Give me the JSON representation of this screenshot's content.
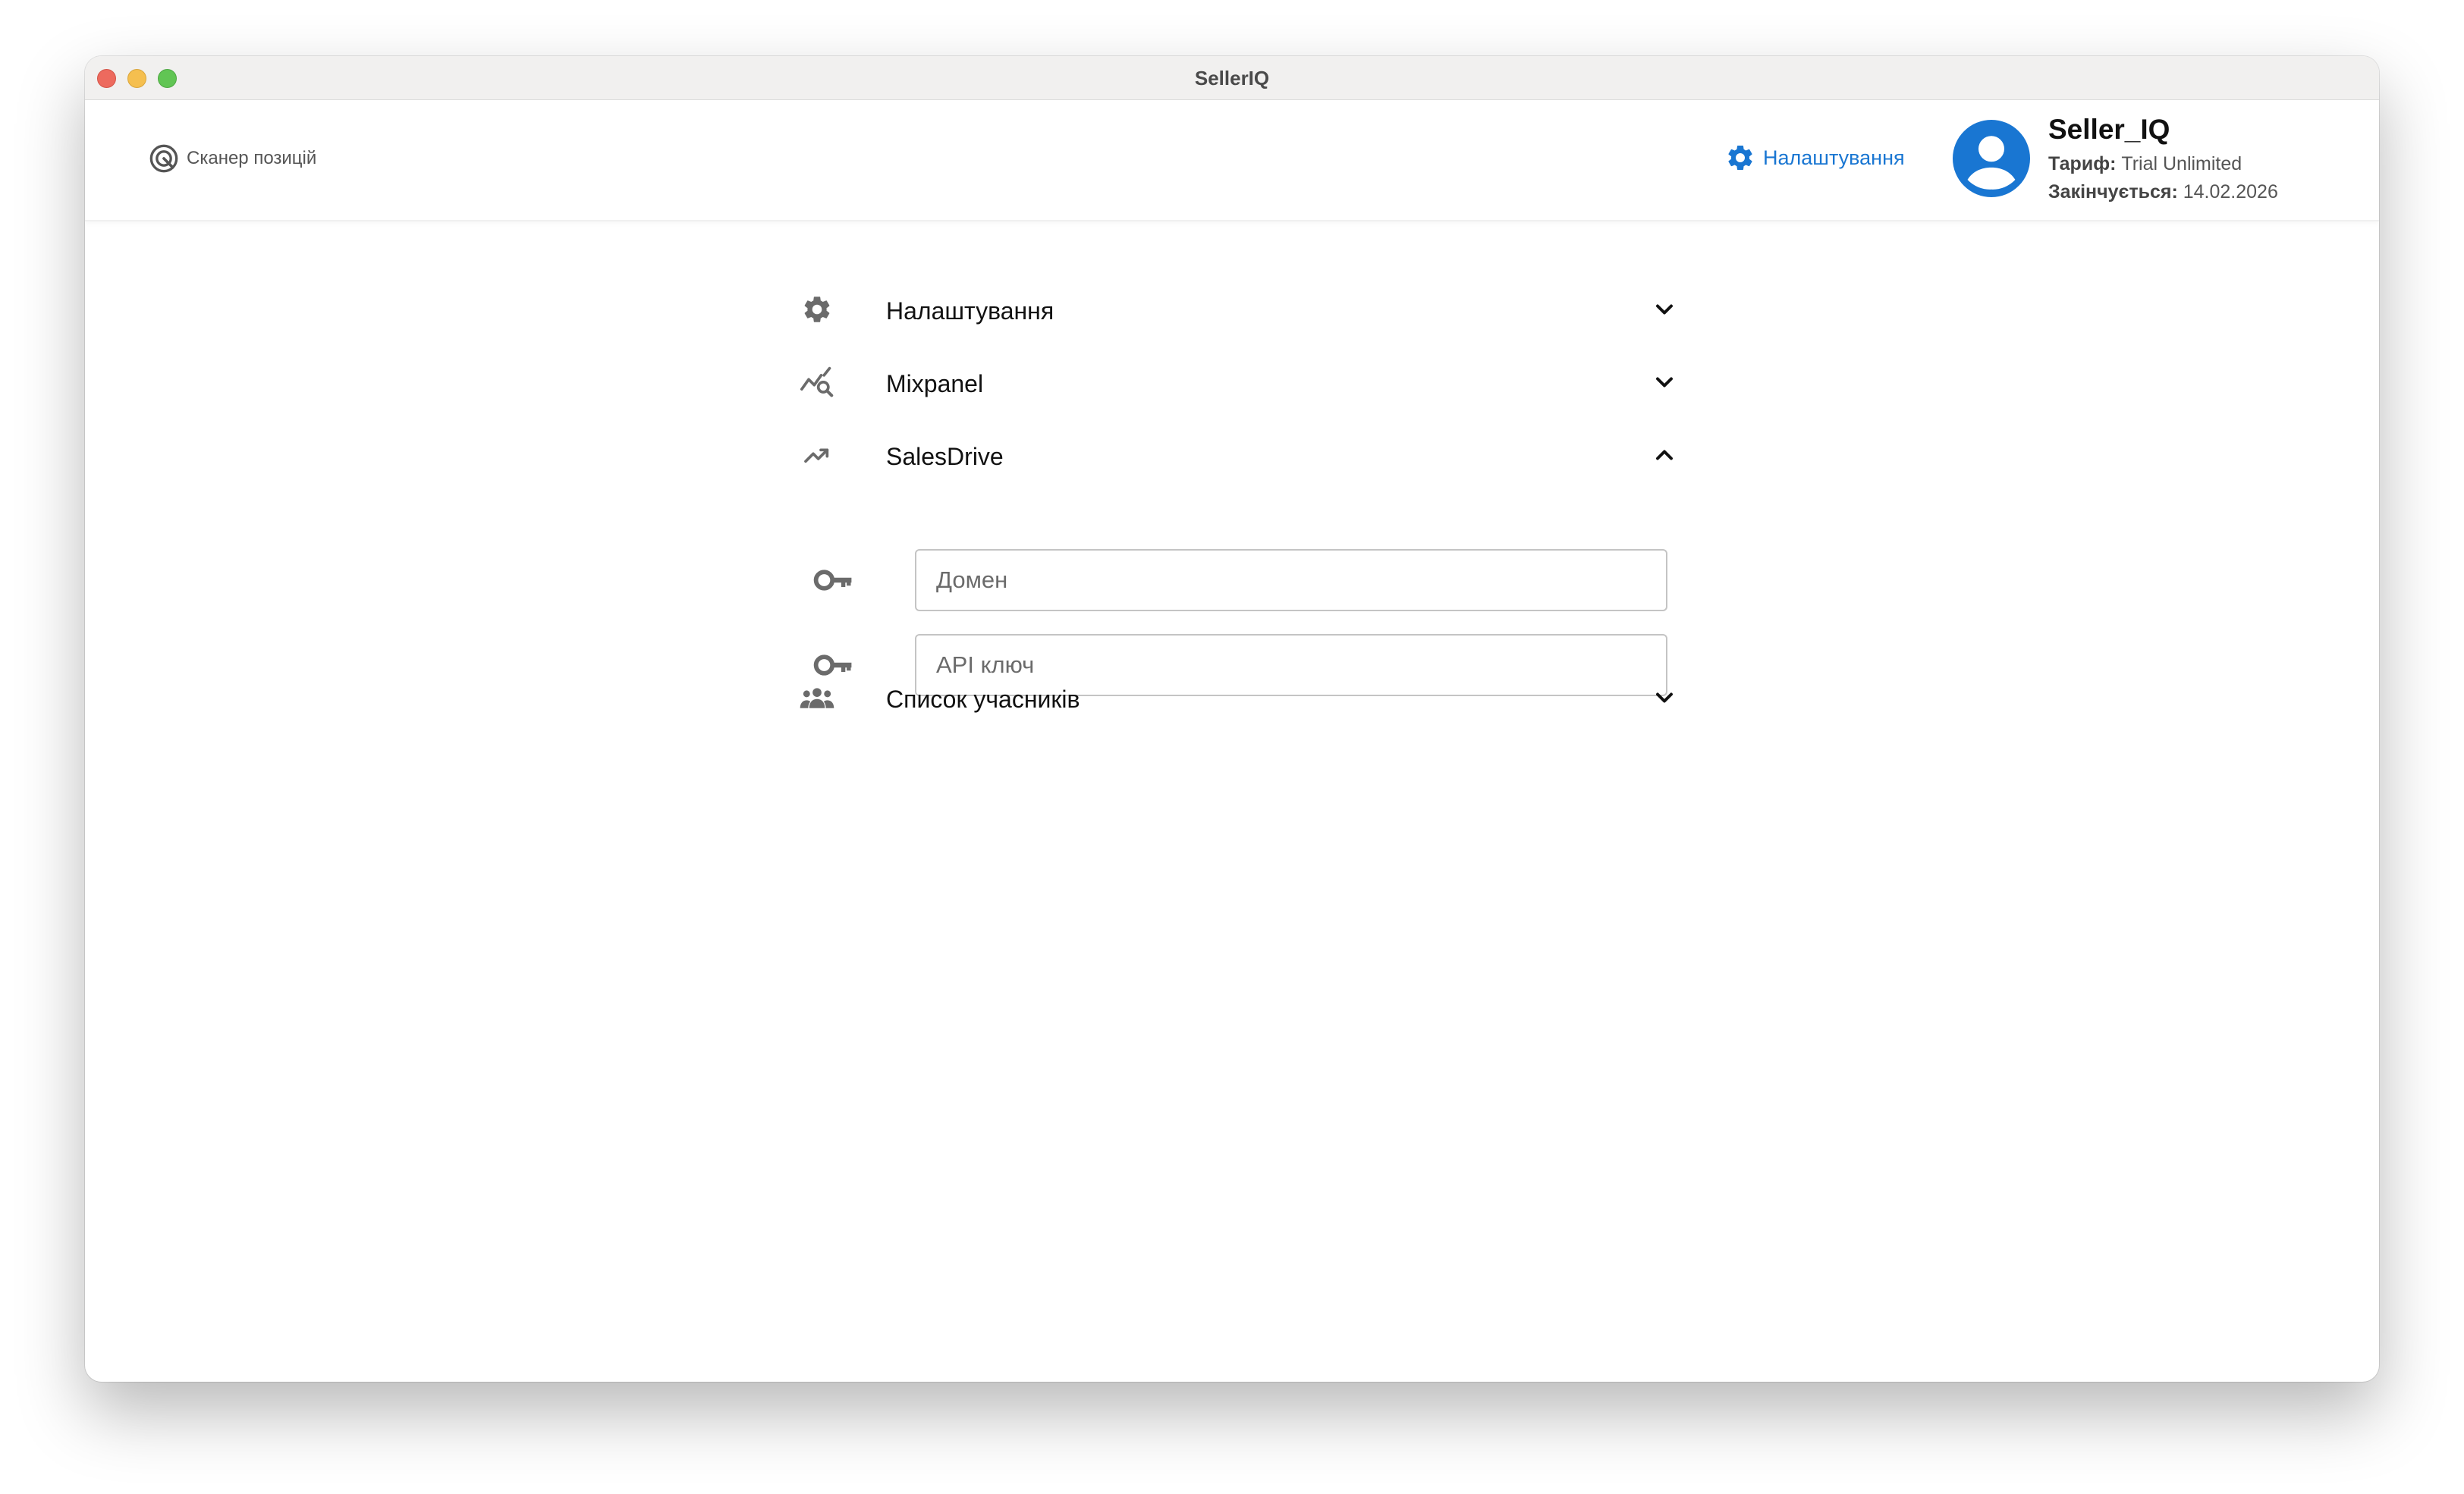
{
  "window": {
    "title": "SellerIQ"
  },
  "header": {
    "scanner_label": "Сканер позицій",
    "settings_label": "Налаштування",
    "user": {
      "name": "Seller_IQ",
      "plan_key": "Тариф:",
      "plan_value": "Trial Unlimited",
      "expires_key": "Закінчується:",
      "expires_value": "14.02.2026"
    }
  },
  "sections": {
    "settings": {
      "label": "Налаштування",
      "icon": "gear-icon",
      "expanded": false
    },
    "mixpanel": {
      "label": "Mixpanel",
      "icon": "analytics-search-icon",
      "expanded": false
    },
    "salesdrive": {
      "label": "SalesDrive",
      "icon": "trending-up-icon",
      "expanded": true,
      "fields": {
        "domain": {
          "placeholder": "Домен",
          "value": ""
        },
        "api_key": {
          "placeholder": "API ключ",
          "value": ""
        }
      }
    },
    "members": {
      "label": "Список учасників",
      "icon": "people-group-icon",
      "expanded": false
    }
  },
  "colors": {
    "accent": "#1976d2",
    "icon_gray": "#6b6b6b",
    "text": "#111111"
  }
}
